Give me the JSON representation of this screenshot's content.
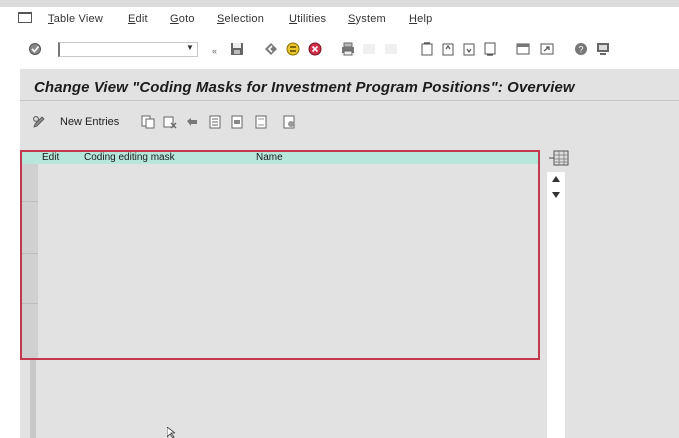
{
  "menubar": {
    "items": [
      "Table View",
      "Edit",
      "Goto",
      "Selection",
      "Utilities",
      "System",
      "Help"
    ]
  },
  "toolbar": {
    "command_field_value": ""
  },
  "page": {
    "title": "Change View \"Coding Masks for Investment Program Positions\": Overview"
  },
  "app_toolbar": {
    "new_entries_label": "New Entries"
  },
  "table": {
    "columns": [
      "Edit",
      "Coding editing mask",
      "Name"
    ],
    "rows": []
  },
  "colors": {
    "work_background": "#e2e2e2",
    "header_background": "#b7e6da",
    "selection_border": "#c4384e"
  }
}
